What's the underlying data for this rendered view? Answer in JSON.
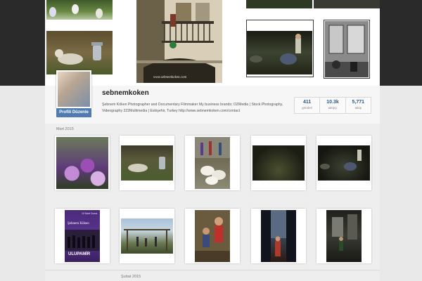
{
  "profile": {
    "username": "sebnemkoken",
    "edit_button": "Profili Düzenle",
    "bio_name": "Şebnem Köken",
    "bio_text": "Şebnem Köken Photographer and Documentary Filmmaker My business brands; OZMedia | Stock Photography, Videography 222Multimedia | Eskişehir, Turkey http://www.sebnemkoken.com/contact"
  },
  "stats": [
    {
      "num": "411",
      "label": "gönderi"
    },
    {
      "num": "10.3k",
      "label": "takipçi"
    },
    {
      "num": "5,771",
      "label": "takip"
    }
  ],
  "cover": {
    "watermark": "www.sebnemkoken.com"
  },
  "feed": {
    "month_1": "Mart 2015",
    "month_2": "Şubat 2015"
  },
  "poster": {
    "title": "Şebnem Köken",
    "subtitle": "ULUPAMİR",
    "top_text": "13 Mart Cuma"
  },
  "colors": {
    "accent": "#4f7bb0",
    "stat_number": "#2b5a8a",
    "cover_bg": "#2a2a2a"
  }
}
